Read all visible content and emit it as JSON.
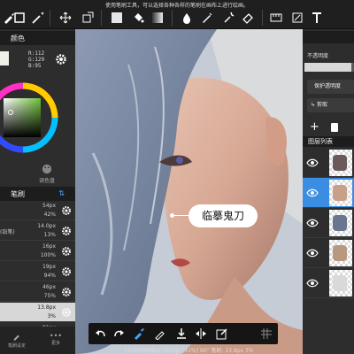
{
  "hint": "使用笔刷工具，可以选择各种各样的笔刷在画布上进行绘画。",
  "toolbar": {
    "icons": [
      "brush-icon",
      "selection-rect-icon",
      "magic-wand-icon",
      "move-icon",
      "transform-icon",
      "fill-color-icon",
      "bucket-icon",
      "gradient-icon",
      "blur-icon",
      "pen-icon",
      "smudge-icon",
      "eraser-icon",
      "ruler-icon",
      "rotate-icon",
      "text-icon"
    ]
  },
  "color_panel": {
    "title": "颜色",
    "rgb": {
      "r": "R:112",
      "g": "G:129",
      "b": "B:95"
    },
    "swatch_color": "#f0efe8",
    "palette_label": "调色盘"
  },
  "brush_panel": {
    "title": "笔刷",
    "sort_icon": "sort-icon",
    "items": [
      {
        "size": "54px",
        "opacity": "42%",
        "name": ""
      },
      {
        "size": "14.0px",
        "opacity": "13%",
        "name": "(铅笔)"
      },
      {
        "size": "16px",
        "opacity": "100%",
        "name": ""
      },
      {
        "size": "19px",
        "opacity": "94%",
        "name": ""
      },
      {
        "size": "46px",
        "opacity": "75%",
        "name": ""
      },
      {
        "size": "13.8px",
        "opacity": "3%",
        "name": ""
      },
      {
        "size": "81px",
        "opacity": "",
        "name": ""
      }
    ],
    "selected_index": 5
  },
  "left_bottom": {
    "brush_settings": "笔刷设定",
    "more": "更多"
  },
  "layer_panel": {
    "opacity_label": "不透明度",
    "opacity_value": 0.95,
    "protect_alpha": "保护透明度",
    "clip": "剪取",
    "list_title": "图层列表",
    "layers": [
      {
        "visible": true,
        "selected": false
      },
      {
        "visible": true,
        "selected": true
      },
      {
        "visible": true,
        "selected": false
      },
      {
        "visible": true,
        "selected": false
      },
      {
        "visible": true,
        "selected": false
      }
    ]
  },
  "bottom_toolbar": {
    "icons": [
      "undo-icon",
      "redo-icon",
      "brush-mode-icon",
      "eyedropper-icon",
      "fill-down-icon",
      "flip-icon",
      "edit-icon",
      "grid-icon"
    ]
  },
  "status": "1536*2048px 350dpi [41%] 90° 笔刷: 13.8px 3%",
  "annotation": "临摹鬼刀",
  "colors": {
    "accent": "#3a8de0",
    "panel": "#2d2d2d",
    "header": "#1d1d1d"
  }
}
